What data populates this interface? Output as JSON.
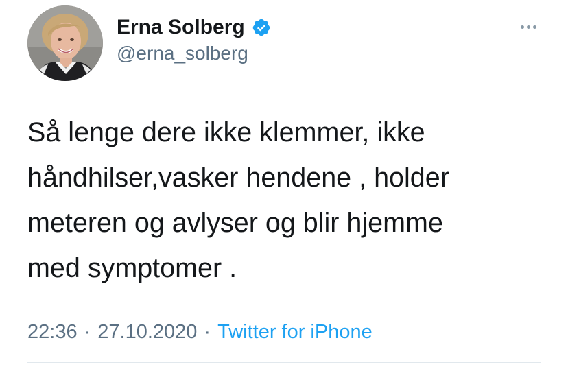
{
  "author": {
    "display_name": "Erna Solberg",
    "handle": "@erna_solberg",
    "verified": true,
    "avatar_icon": "profile-photo"
  },
  "tweet": {
    "lines": [
      "Så lenge dere ikke klemmer, ikke",
      "håndhilser,vasker hendene , holder",
      "meteren og avlyser og blir hjemme",
      "med symptomer ."
    ]
  },
  "meta": {
    "time": "22:36",
    "separator": "·",
    "date": "27.10.2020",
    "source": "Twitter for iPhone"
  },
  "colors": {
    "text": "#14171a",
    "secondary": "#5b7083",
    "link": "#1da1f2",
    "verified_badge": "#1da1f2",
    "divider": "#e1e8ed"
  },
  "icons": {
    "verified": "verified-badge-icon",
    "more": "more-options-icon"
  }
}
